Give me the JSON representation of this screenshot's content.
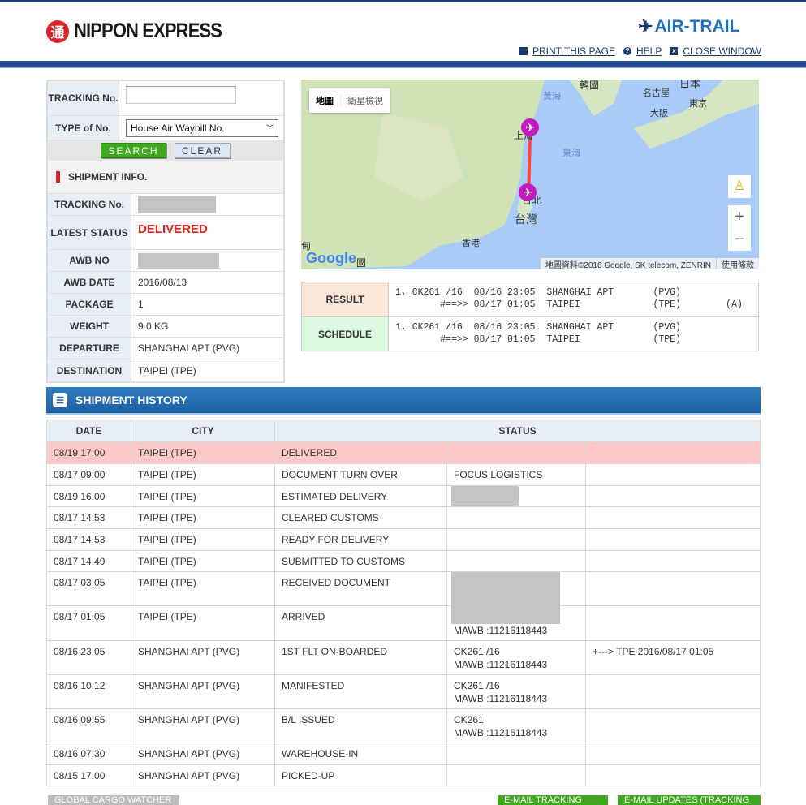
{
  "header": {
    "brand": "NIPPON EXPRESS",
    "brand_seal": "通",
    "airtrail": "AIR-TRAIL",
    "links": [
      "PRINT THIS PAGE",
      "HELP",
      "CLOSE WINDOW"
    ]
  },
  "search": {
    "tracking_label": "TRACKING No.",
    "tracking_value": "",
    "type_label": "TYPE of No.",
    "type_value": "House Air Waybill No.",
    "search_btn": "SEARCH",
    "clear_btn": "CLEAR"
  },
  "info": {
    "title": "SHIPMENT INFO.",
    "rows": [
      {
        "label": "TRACKING No.",
        "value": ""
      },
      {
        "label": "LATEST STATUS",
        "value": "DELIVERED"
      },
      {
        "label": "AWB NO",
        "value": ""
      },
      {
        "label": "AWB DATE",
        "value": "2016/08/13"
      },
      {
        "label": "PACKAGE",
        "value": "1"
      },
      {
        "label": "WEIGHT",
        "value": "9.0 KG"
      },
      {
        "label": "DEPARTURE",
        "value": "SHANGHAI APT (PVG)"
      },
      {
        "label": "DESTINATION",
        "value": "TAIPEI (TPE)"
      }
    ]
  },
  "map": {
    "tab_map": "地圖",
    "tab_sat": "衛星檢視",
    "labels": {
      "korea": "韓國",
      "yellow_sea": "黃海",
      "east_sea": "東海",
      "japan": "日本",
      "nagoya": "名古屋",
      "tokyo": "東京",
      "osaka": "大阪",
      "shanghai": "上海",
      "taipei": "台北",
      "taiwan": "台灣",
      "hongkong": "香港",
      "burma": "甸",
      "china": "國"
    },
    "attribution": "地圖資料©2016 Google, SK telecom, ZENRIN",
    "terms": "使用條款",
    "google": "Google"
  },
  "flight": {
    "result_label": "RESULT",
    "result_text": "1. CK261 /16  08/16 23:05  SHANGHAI APT       (PVG)\n        #==>> 08/17 01:05  TAIPEI             (TPE)        (A)",
    "schedule_label": "SCHEDULE",
    "schedule_text": "1. CK261 /16  08/16 23:05  SHANGHAI APT       (PVG)\n        #==>> 08/17 01:05  TAIPEI             (TPE)"
  },
  "history": {
    "title": "SHIPMENT HISTORY",
    "columns": [
      "DATE",
      "CITY",
      "STATUS"
    ],
    "rows": [
      {
        "date": "08/19 17:00",
        "city": "TAIPEI (TPE)",
        "status": "DELIVERED",
        "d1": "",
        "d2": ""
      },
      {
        "date": "08/17 09:00",
        "city": "TAIPEI (TPE)",
        "status": "DOCUMENT TURN OVER",
        "d1": "FOCUS LOGISTICS",
        "d2": ""
      },
      {
        "date": "08/19 16:00",
        "city": "TAIPEI (TPE)",
        "status": "ESTIMATED DELIVERY",
        "d1": "",
        "d2": ""
      },
      {
        "date": "08/17 14:53",
        "city": "TAIPEI (TPE)",
        "status": "CLEARED CUSTOMS",
        "d1": "",
        "d2": ""
      },
      {
        "date": "08/17 14:53",
        "city": "TAIPEI (TPE)",
        "status": "READY FOR DELIVERY",
        "d1": "",
        "d2": ""
      },
      {
        "date": "08/17 14:49",
        "city": "TAIPEI (TPE)",
        "status": "SUBMITTED TO CUSTOMS",
        "d1": "",
        "d2": ""
      },
      {
        "date": "08/17 03:05",
        "city": "TAIPEI (TPE)",
        "status": "RECEIVED DOCUMENT",
        "d1": "",
        "d2": ""
      },
      {
        "date": "08/17 01:05",
        "city": "TAIPEI (TPE)",
        "status": "ARRIVED",
        "d1": "MAWB :11216118443",
        "d2": ""
      },
      {
        "date": "08/16 23:05",
        "city": "SHANGHAI APT (PVG)",
        "status": "1ST FLT ON-BOARDED",
        "d1": "CK261 /16\nMAWB :11216118443",
        "d2": "+---> TPE 2016/08/17 01:05"
      },
      {
        "date": "08/16 10:12",
        "city": "SHANGHAI APT (PVG)",
        "status": "MANIFESTED",
        "d1": "CK261 /16\nMAWB :11216118443",
        "d2": ""
      },
      {
        "date": "08/16 09:55",
        "city": "SHANGHAI APT (PVG)",
        "status": "B/L ISSUED",
        "d1": "CK261\nMAWB :11216118443",
        "d2": ""
      },
      {
        "date": "08/16 07:30",
        "city": "SHANGHAI APT (PVG)",
        "status": "WAREHOUSE-IN",
        "d1": "",
        "d2": ""
      },
      {
        "date": "08/15 17:00",
        "city": "SHANGHAI APT (PVG)",
        "status": "PICKED-UP",
        "d1": "",
        "d2": ""
      }
    ]
  },
  "footer": {
    "global": "GLOBAL CARGO WATCHER",
    "email_info": "E-MAIL TRACKING INFO",
    "email_updates": "E-MAIL UPDATES (TRACKING INFO)"
  }
}
